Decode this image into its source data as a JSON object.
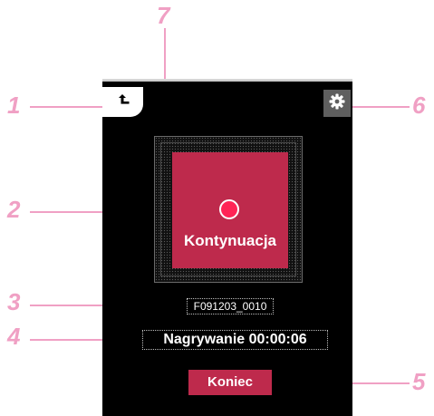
{
  "callouts": {
    "c1": "1",
    "c2": "2",
    "c3": "3",
    "c4": "4",
    "c5": "5",
    "c6": "6",
    "c7": "7"
  },
  "icons": {
    "back": "back-arrow-icon",
    "settings": "gear-icon",
    "record": "record-dot-icon"
  },
  "recorder": {
    "continue_label": "Kontynuacja",
    "file_name": "F091203_0010",
    "status": "Nagrywanie 00:00:06",
    "end_label": "Koniec"
  },
  "colors": {
    "accent": "#be2a4c",
    "record_dot": "#ff2456",
    "callout": "#f0a0c4",
    "screen_bg": "#000000"
  }
}
